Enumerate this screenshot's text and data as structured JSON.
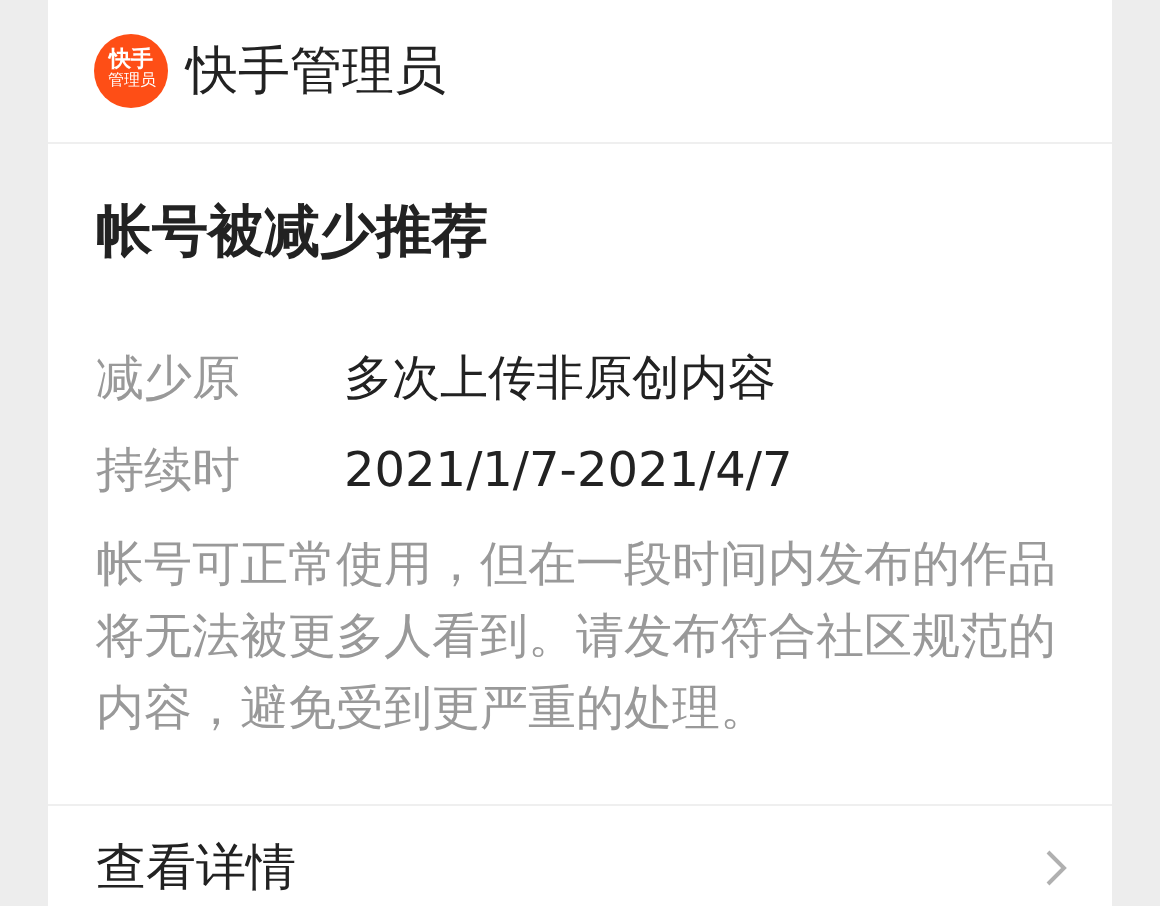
{
  "header": {
    "logo_text": [
      "快手",
      "管理员"
    ],
    "title": "快手管理员"
  },
  "notice": {
    "title": "帐号被减少推荐",
    "fields": [
      {
        "label": "减少原",
        "value": "多次上传非原创内容"
      },
      {
        "label": "持续时",
        "value": "2021/1/7-2021/4/7"
      }
    ],
    "description": "帐号可正常使用，但在一段时间内发布的作品将无法被更多人看到。请发布符合社区规范的内容，避免受到更严重的处理。"
  },
  "details_link": {
    "label": "查看详情"
  }
}
